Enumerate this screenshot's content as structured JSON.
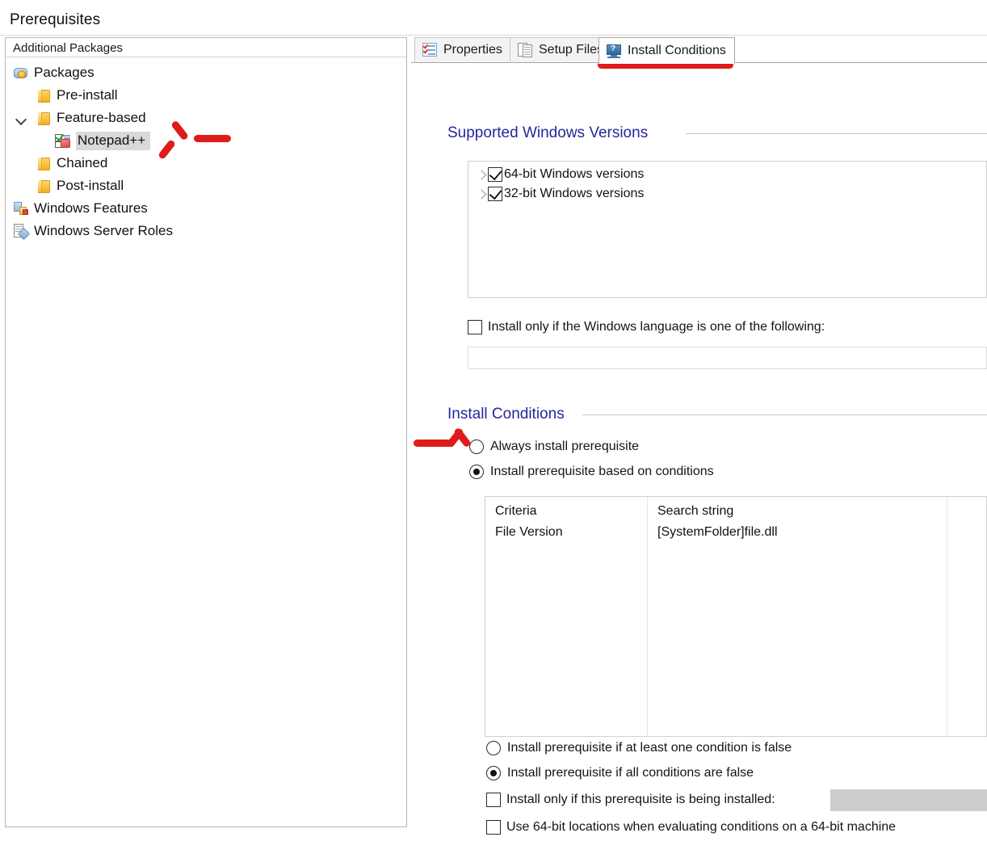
{
  "window": {
    "title": "Prerequisites"
  },
  "tree": {
    "header": "Additional Packages",
    "nodes": [
      {
        "label": "Packages",
        "icon": "packages-icon",
        "indent": 0,
        "twisty": "none",
        "selected": false
      },
      {
        "label": "Pre-install",
        "icon": "folder-icon",
        "indent": 1,
        "twisty": "none",
        "selected": false
      },
      {
        "label": "Feature-based",
        "icon": "folder-icon",
        "indent": 1,
        "twisty": "expanded",
        "selected": false
      },
      {
        "label": "Notepad++",
        "icon": "package-item-icon",
        "indent": 2,
        "twisty": "none",
        "selected": true
      },
      {
        "label": "Chained",
        "icon": "folder-icon",
        "indent": 1,
        "twisty": "none",
        "selected": false
      },
      {
        "label": "Post-install",
        "icon": "folder-icon",
        "indent": 1,
        "twisty": "none",
        "selected": false
      },
      {
        "label": "Windows Features",
        "icon": "windows-features-icon",
        "indent": 0,
        "twisty": "none",
        "selected": false
      },
      {
        "label": "Windows Server Roles",
        "icon": "server-roles-icon",
        "indent": 0,
        "twisty": "none",
        "selected": false
      }
    ]
  },
  "tabs": [
    {
      "label": "Properties",
      "icon": "properties-checklist-icon",
      "active": false
    },
    {
      "label": "Setup Files",
      "icon": "documents-icon",
      "active": false
    },
    {
      "label": "Install Conditions",
      "icon": "monitor-question-icon",
      "active": true
    }
  ],
  "supported_versions": {
    "title": "Supported Windows Versions",
    "items": [
      {
        "label": "64-bit Windows versions",
        "checked": true,
        "expandable": true
      },
      {
        "label": "32-bit Windows versions",
        "checked": true,
        "expandable": true
      }
    ],
    "language_filter": {
      "label": "Install only if the Windows language is one of the following:",
      "checked": false,
      "value": "",
      "placeholder": ""
    }
  },
  "install_conditions": {
    "title": "Install Conditions",
    "mode_options": [
      {
        "label": "Always install prerequisite",
        "selected": false
      },
      {
        "label": "Install prerequisite based on conditions",
        "selected": true
      }
    ],
    "table": {
      "columns": [
        "Criteria",
        "Search string"
      ],
      "rows": [
        {
          "criteria": "File Version",
          "search_string": "[SystemFolder]file.dll"
        }
      ]
    },
    "evaluation_options": [
      {
        "label": "Install prerequisite if at least one condition is false",
        "selected": false
      },
      {
        "label": "Install prerequisite if all conditions are false",
        "selected": true
      }
    ],
    "only_if_installed": {
      "label": "Install only if this prerequisite is being installed:",
      "checked": false,
      "value": "",
      "disabled": true
    },
    "use_64bit_locations": {
      "label": "Use 64-bit locations when evaluating conditions on a 64-bit machine",
      "checked": false
    }
  },
  "annotations": {
    "tab_underline": "red-underline-install-conditions-tab",
    "arrow_tree": "red-arrow-pointing-left-at-notepadpp",
    "arrow_radio": "red-arrow-pointing-right-at-conditions-radio"
  },
  "colors": {
    "group_title": "#26269c",
    "annotation_red": "#e01b1b",
    "selection_gray": "#d9d9d9",
    "disabled_gray": "#cccccc"
  }
}
